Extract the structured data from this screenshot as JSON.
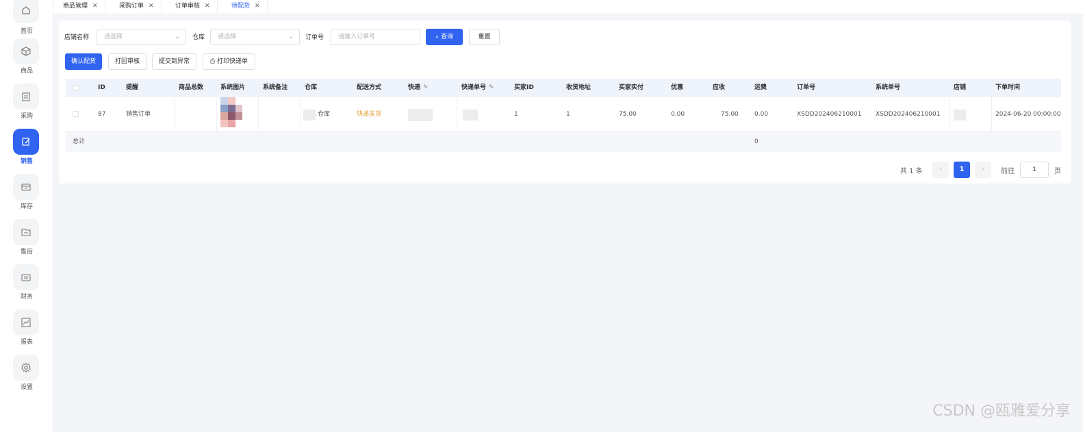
{
  "sidebar": {
    "items": [
      {
        "label": "首页",
        "icon": "home-icon"
      },
      {
        "label": "商品",
        "icon": "box-icon"
      },
      {
        "label": "采购",
        "icon": "calendar-icon"
      },
      {
        "label": "销售",
        "icon": "edit-icon"
      },
      {
        "label": "库存",
        "icon": "inventory-icon"
      },
      {
        "label": "售后",
        "icon": "folder-icon"
      },
      {
        "label": "财务",
        "icon": "wallet-icon"
      },
      {
        "label": "报表",
        "icon": "chart-icon"
      },
      {
        "label": "设置",
        "icon": "gear-icon"
      }
    ],
    "active_index": 3,
    "accent_color": "#2f63f0"
  },
  "tabs": [
    {
      "label": "商品管理"
    },
    {
      "label": "采购订单"
    },
    {
      "label": "订单审核"
    },
    {
      "label": "待配货"
    }
  ],
  "filters": {
    "shop_label": "店铺名称",
    "shop_placeholder": "请选择",
    "warehouse_label": "仓库",
    "warehouse_placeholder": "请选择",
    "order_label": "订单号",
    "order_placeholder": "请输入订单号",
    "search_label": "查询",
    "reset_label": "重置"
  },
  "actions": {
    "confirm_label": "确认配货",
    "print_audit_label": "打回审核",
    "submit_abnormal_label": "提交到异常",
    "print_express_label": "打印快递单"
  },
  "table": {
    "headers": [
      "ID",
      "提醒",
      "商品总数",
      "系统图片",
      "系统备注",
      "仓库",
      "配送方式",
      "快递",
      "快递单号",
      "买家ID",
      "收货地址",
      "买家实付",
      "优惠",
      "应收",
      "运费",
      "订单号",
      "系统单号",
      "店铺",
      "下单时间"
    ],
    "rows": [
      {
        "id": "87",
        "remind": "销售订单",
        "warehouse": "仓库",
        "delivery": "快递发货",
        "buyer_id": "1",
        "address": "1",
        "paid": "75.00",
        "discount": "0.00",
        "receivable": "75.00",
        "shipping": "0.00",
        "order_no": "XSDD202406210001",
        "system_no": "XSDD202406210001",
        "order_time": "2024-06-20 00:00:00"
      }
    ],
    "footer_label": "总计",
    "footer_shipping_total": "0"
  },
  "pagination": {
    "total_text": "共 1 条",
    "current_page": "1",
    "goto_label": "前往",
    "goto_value": "1",
    "page_unit": "页"
  },
  "watermark": "CSDN @瓯雅爱分享"
}
